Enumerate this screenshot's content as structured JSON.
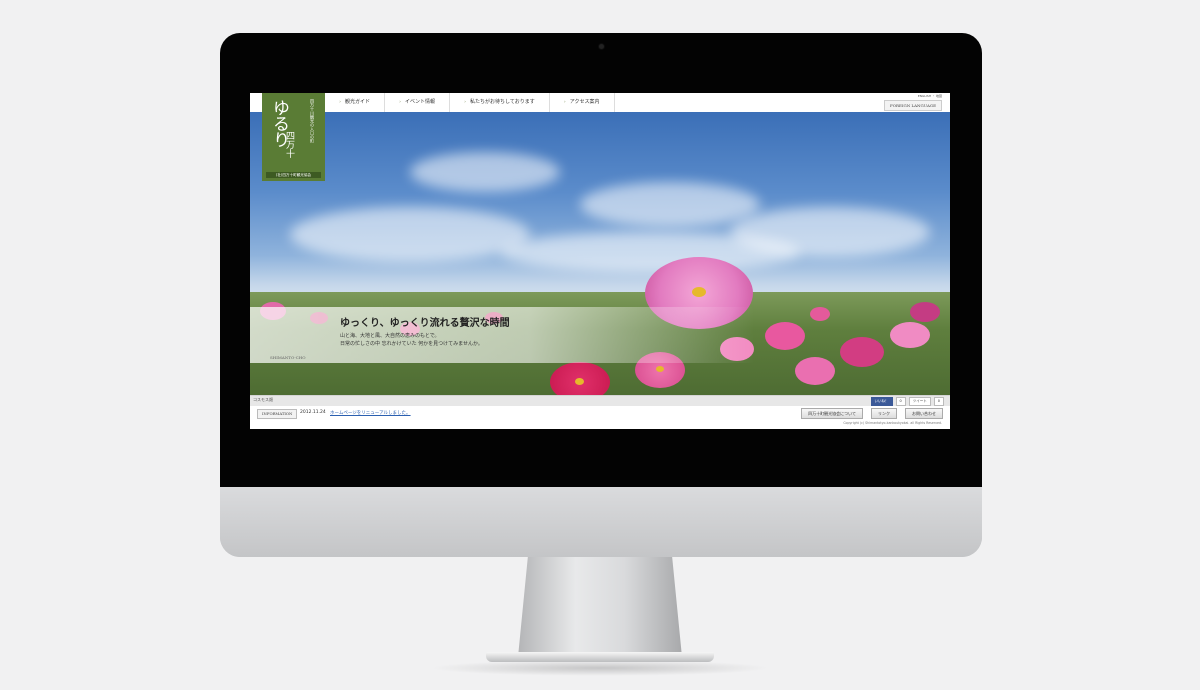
{
  "site": {
    "logo": {
      "title": "ゆるり",
      "place": "四万十",
      "tagline": "四万十川観光の入口の町",
      "association": "(社)四万十町観光協会"
    },
    "nav": [
      {
        "label": "観光ガイド"
      },
      {
        "label": "イベント情報"
      },
      {
        "label": "私たちがお待ちしております"
      },
      {
        "label": "アクセス案内"
      }
    ],
    "top_links": "ENGLISH ・ 地図",
    "language_button": "FOREIGN LANGUAGE"
  },
  "hero": {
    "title": "ゆっくり、ゆっくり流れる贅沢な時間",
    "body_line1": "山と海、大地と風、大自然の恵みのもとで。",
    "body_line2": "日常の忙しさの中 忘れかけていた 何かを見つけてみませんか。",
    "small_caption": "SHIMANTO-CHO",
    "photo_label": "コスモス畑",
    "share": {
      "facebook": "いいね！",
      "count1": "0",
      "tweet": "ツイート",
      "count2": "0"
    }
  },
  "info": {
    "label": "INFORMATION",
    "date": "2012.11.24",
    "link_text": "ホームページをリニューアルしました。"
  },
  "footer": {
    "buttons": [
      {
        "label": "四万十町観光協会について"
      },
      {
        "label": "リンク"
      },
      {
        "label": "お問い合わせ"
      }
    ],
    "copyright": "Copyright (c) Shimantotyo-kankoukyokai. all Rights Reserved."
  },
  "colors": {
    "logo_green": "#5a7c35",
    "sky_blue": "#3b6fb7",
    "cosmos_pink": "#e2559b",
    "link_blue": "#2a5fb0"
  }
}
